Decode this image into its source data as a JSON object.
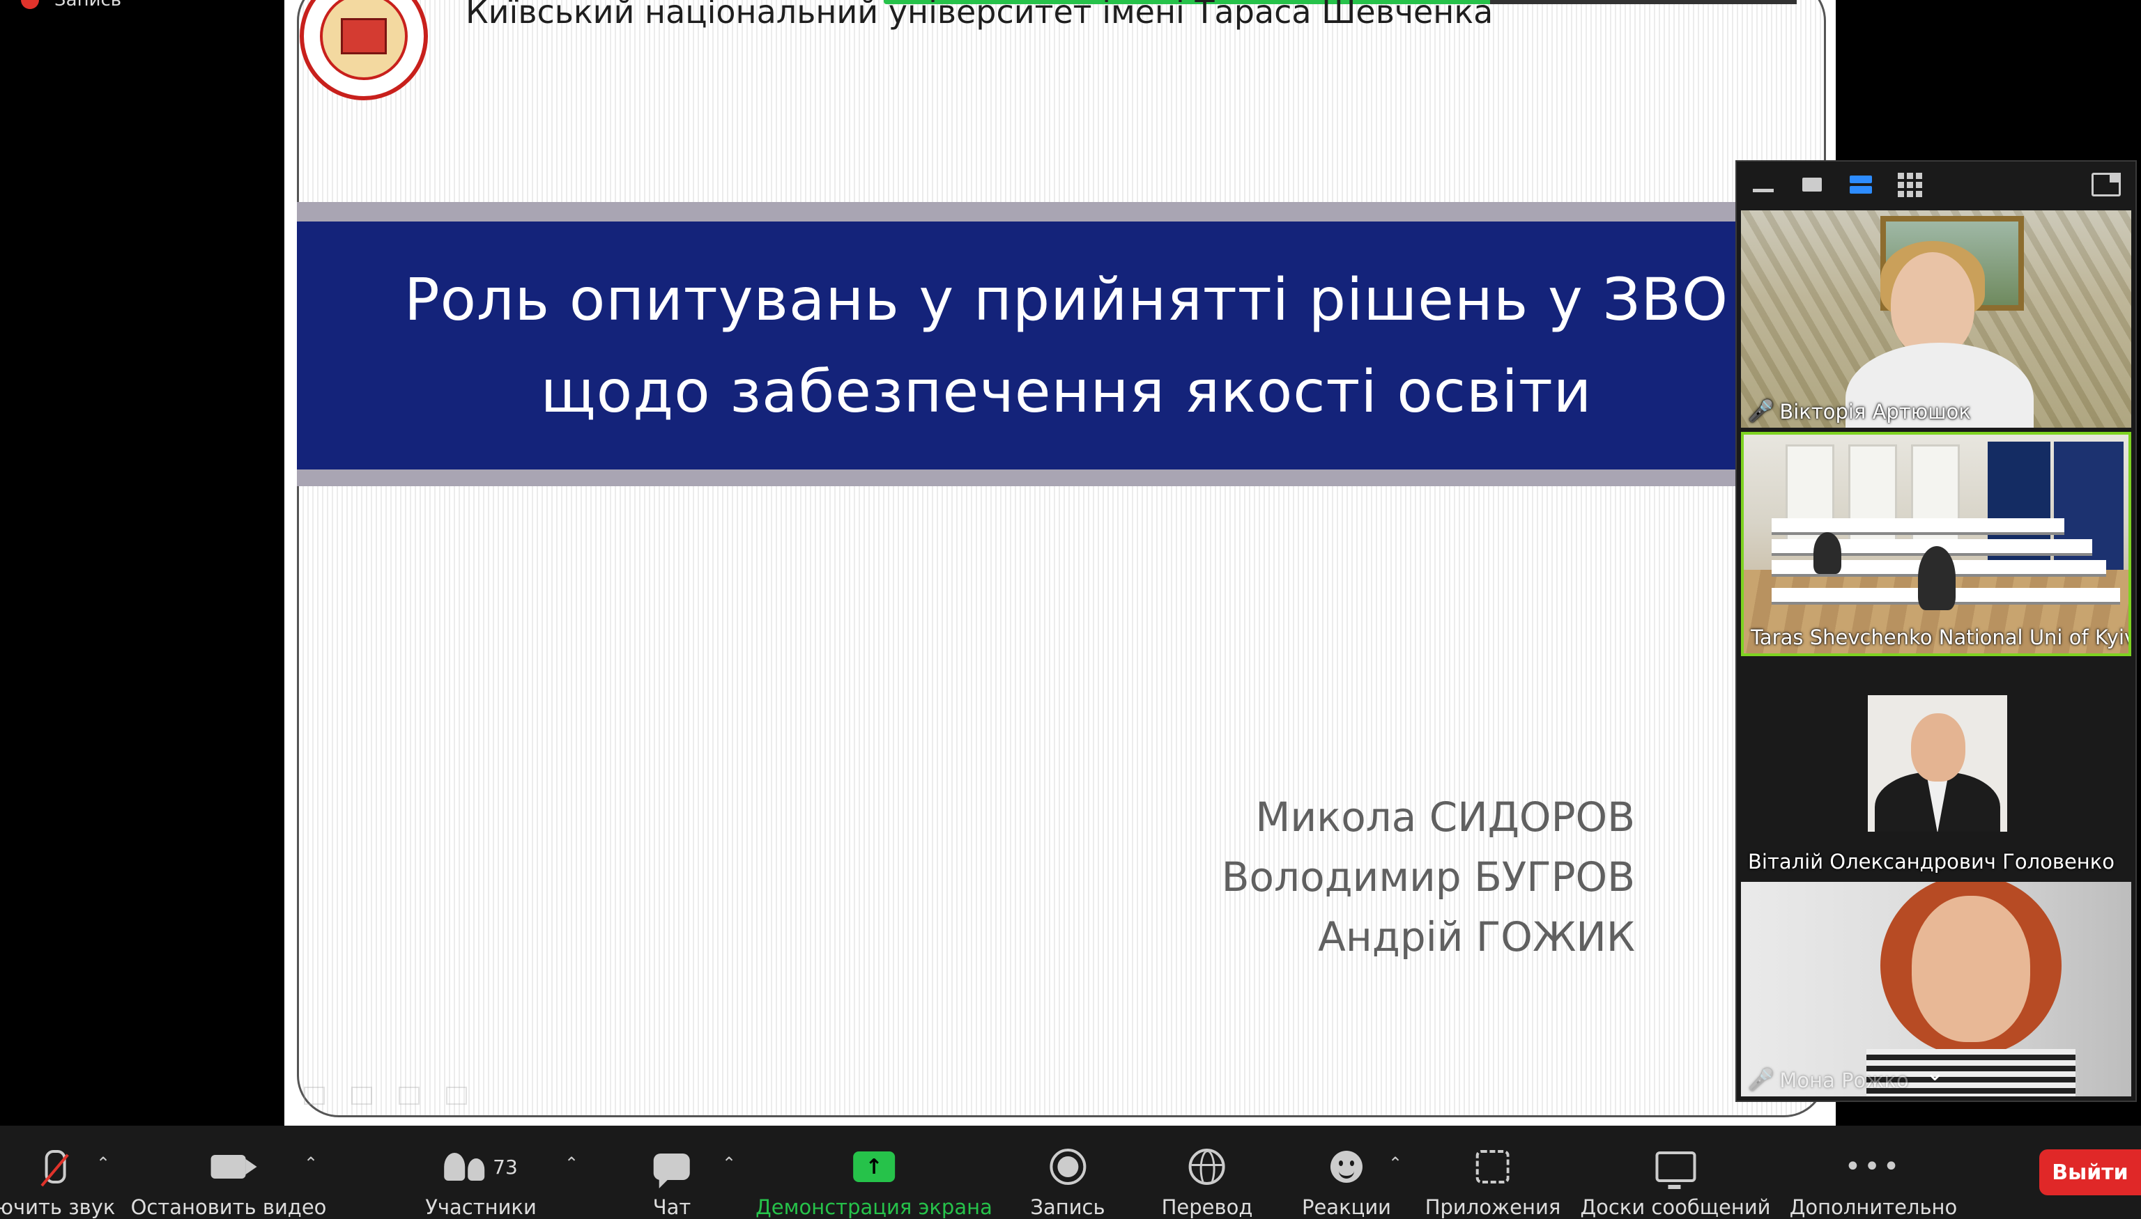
{
  "recording": {
    "label": "Запись"
  },
  "slide": {
    "university": "Київський національний університет імені Тараса Шевченка",
    "title_lines": [
      "Роль опитувань у прийнятті рішень у ЗВО",
      "щодо забезпечення якості освіти"
    ],
    "authors": [
      "Микола СИДОРОВ",
      "Володимир БУГРОВ",
      "Андрій ГОЖИК"
    ]
  },
  "gallery": {
    "participants": [
      {
        "name": "Вікторія Артюшок",
        "muted": true,
        "active": false
      },
      {
        "name": "Taras Shevchenko National Uni of Kyiv",
        "muted": false,
        "active": true
      },
      {
        "name": "Віталій Олександрович Головенко",
        "muted": false,
        "active": false
      },
      {
        "name": "Мона Рожко",
        "muted": true,
        "active": false
      }
    ]
  },
  "toolbar": {
    "mute_label": "ючить звук",
    "video_label": "Остановить видео",
    "participants_label": "Участники",
    "participants_count": "73",
    "chat_label": "Чат",
    "share_label": "Демонстрация экрана",
    "record_label": "Запись",
    "translate_label": "Перевод",
    "reactions_label": "Реакции",
    "apps_label": "Приложения",
    "whiteboards_label": "Доски сообщений",
    "more_label": "Дополнительно",
    "leave_label": "Выйти"
  },
  "colors": {
    "share_green": "#26c24a",
    "active_speaker": "#7ed321",
    "title_band": "#14237a",
    "leave_red": "#e02828"
  }
}
